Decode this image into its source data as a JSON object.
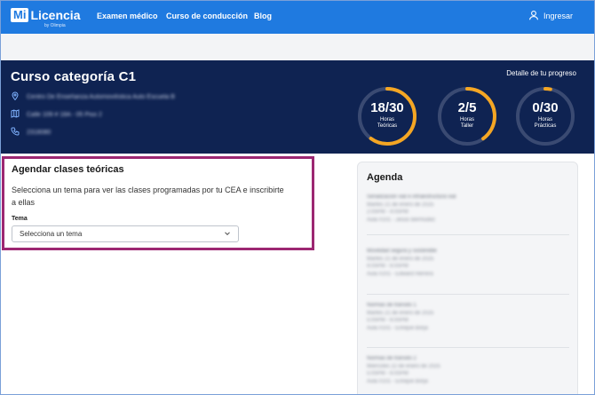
{
  "nav": {
    "logo_mi": "Mi",
    "logo_text": "Licencia",
    "logo_byline": "by Olimpia",
    "links": [
      "Examen médico",
      "Curso de conducción",
      "Blog"
    ],
    "login": "Ingresar"
  },
  "hero": {
    "title": "Curso categoría C1",
    "progress_link": "Detalle de tu progreso",
    "school": "Centro De Enseñanza Automovilística Auto Escuela B",
    "address": "Calle 109 # 18A - 05 Piso 2",
    "phone": "2318080",
    "gauges": [
      {
        "value": "18/30",
        "label1": "Horas",
        "label2": "Teóricas",
        "fraction": 0.6
      },
      {
        "value": "2/5",
        "label1": "Horas",
        "label2": "Taller",
        "fraction": 0.4
      },
      {
        "value": "0/30",
        "label1": "Horas",
        "label2": "Prácticas",
        "fraction": 0.0
      }
    ],
    "colors": {
      "accent": "#f5a623",
      "track": "#3a4a72"
    }
  },
  "schedule": {
    "title": "Agendar clases teóricas",
    "description": "Selecciona un tema para ver las clases programadas por tu CEA e inscribirte a ellas",
    "field_label": "Tema",
    "select_placeholder": "Selecciona un tema"
  },
  "agenda": {
    "title": "Agenda",
    "items": [
      {
        "lines": [
          "Señalización vial e infraestructura vial",
          "Martes 21 de enero de 2025",
          "2:00PM - 4:00PM",
          "Aula #101 - Jesús Bermúdez"
        ]
      },
      {
        "lines": [
          "Movilidad segura y sostenible",
          "Martes 21 de enero de 2025",
          "4:00PM - 6:00PM",
          "Aula #201 - Edward Herrera"
        ]
      },
      {
        "lines": [
          "Normas de tránsito 1",
          "Martes 21 de enero de 2025",
          "5:00PM - 6:00PM",
          "Aula #101 - Enrique Borja"
        ]
      },
      {
        "lines": [
          "Normas de tránsito 2",
          "Miércoles 22 de enero de 2025",
          "5:00PM - 6:00PM",
          "Aula #101 - Enrique Borja"
        ]
      }
    ]
  }
}
